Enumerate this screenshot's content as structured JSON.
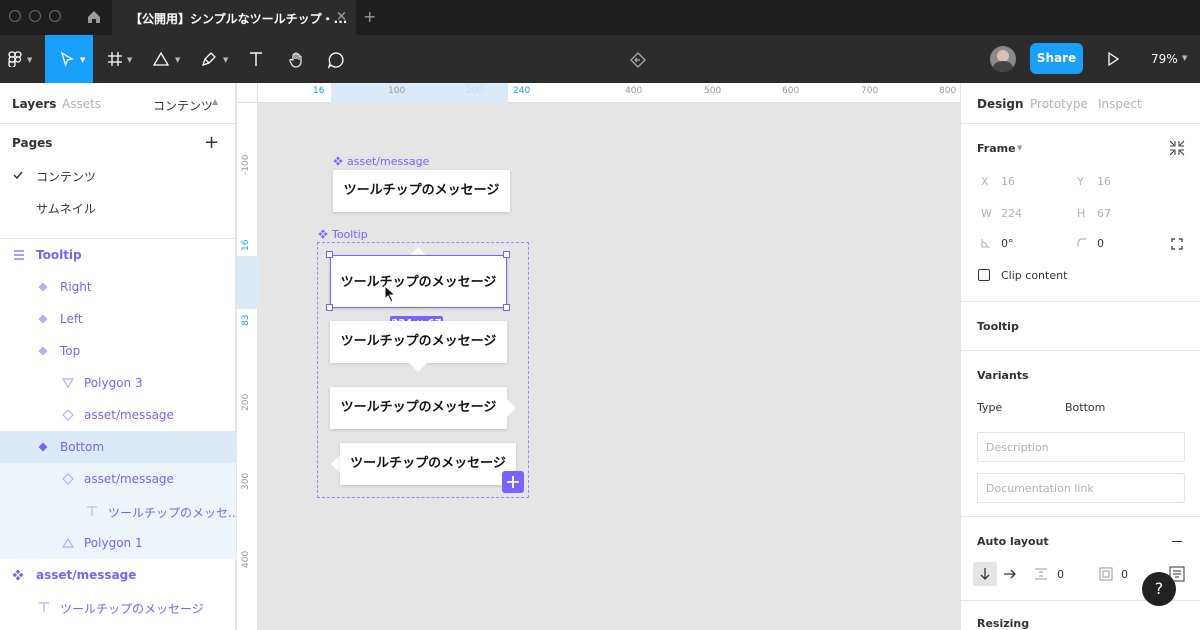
{
  "window": {
    "tab_title": "【公開用】シンプルなツールチップ・...",
    "tab_close": "×",
    "new_tab": "+"
  },
  "toolbar": {
    "share_label": "Share",
    "zoom": "79%"
  },
  "left_panel": {
    "tabs": {
      "layers": "Layers",
      "assets": "Assets",
      "page_menu": "コンテンツ"
    },
    "pages_title": "Pages",
    "add_page": "+",
    "pages": [
      {
        "label": "コンテンツ",
        "active": true
      },
      {
        "label": "サムネイル",
        "active": false
      }
    ],
    "layers": [
      {
        "label": "Tooltip",
        "icon": "frame-icon"
      },
      {
        "label": "Right",
        "icon": "variant-icon"
      },
      {
        "label": "Left",
        "icon": "variant-icon"
      },
      {
        "label": "Top",
        "icon": "variant-icon"
      },
      {
        "label": "Polygon 3",
        "icon": "polygon-down-icon"
      },
      {
        "label": "asset/message",
        "icon": "instance-icon"
      },
      {
        "label": "Bottom",
        "icon": "variant-icon"
      },
      {
        "label": "asset/message",
        "icon": "instance-icon"
      },
      {
        "label": "ツールチップのメッセ...",
        "icon": "text-icon"
      },
      {
        "label": "Polygon 1",
        "icon": "polygon-up-icon"
      },
      {
        "label": "asset/message",
        "icon": "component-icon"
      },
      {
        "label": "ツールチップのメッセージ",
        "icon": "text-icon"
      }
    ]
  },
  "canvas": {
    "ruler_top": [
      "16",
      "100",
      "200",
      "240",
      "400",
      "500",
      "600",
      "700",
      "800"
    ],
    "ruler_left": [
      "-100",
      "16",
      "83",
      "200",
      "300",
      "400"
    ],
    "asset_label": "asset/message",
    "tooltip_label": "Tooltip",
    "message": "ツールチップのメッセージ",
    "size_badge": "224 × 67"
  },
  "right_panel": {
    "tabs": {
      "design": "Design",
      "prototype": "Prototype",
      "inspect": "Inspect"
    },
    "frame": {
      "title": "Frame",
      "x_label": "X",
      "x": "16",
      "y_label": "Y",
      "y": "16",
      "w_label": "W",
      "w": "224",
      "h_label": "H",
      "h": "67",
      "rotation": "0°",
      "radius": "0",
      "clip_content": "Clip content"
    },
    "component_title": "Tooltip",
    "variants": {
      "title": "Variants",
      "type_label": "Type",
      "type_value": "Bottom",
      "description_placeholder": "Description",
      "doc_placeholder": "Documentation link"
    },
    "auto_layout": {
      "title": "Auto layout",
      "spacing": "0",
      "padding": "0"
    },
    "resizing_title": "Resizing",
    "help": "?"
  },
  "colors": {
    "accent": "#7b61ff",
    "toolbar_active": "#18a0fb",
    "share": "#18a0fb"
  }
}
